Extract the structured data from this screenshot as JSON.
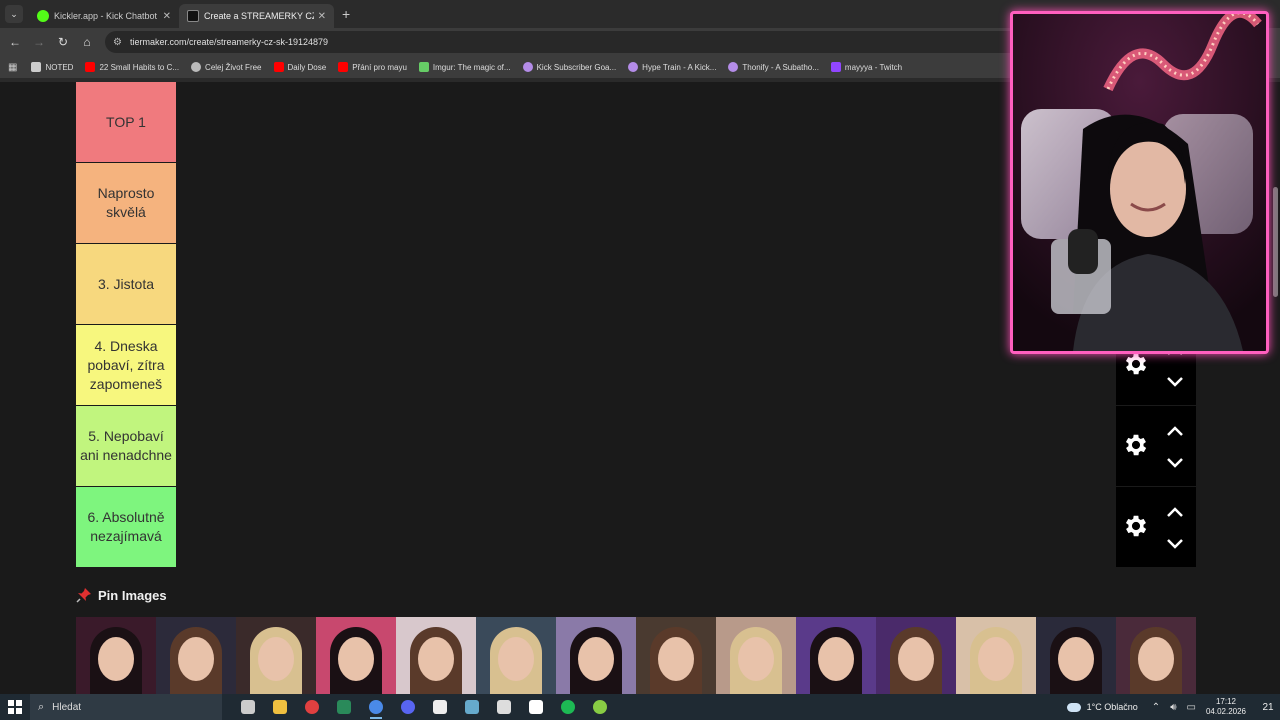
{
  "browser": {
    "tabs": [
      {
        "title": "Kickler.app - Kick Chatbot and",
        "active": false
      },
      {
        "title": "Create a STREAMERKY CZ/SK Ti",
        "active": true
      }
    ],
    "url": "tiermaker.com/create/streamerky-cz-sk-19124879",
    "bookmarks": [
      {
        "label": "NOTED",
        "color": "#cccccc"
      },
      {
        "label": "22 Small Habits to C...",
        "color": "#ff0000"
      },
      {
        "label": "Celej Život Free",
        "color": "#bbbbbb"
      },
      {
        "label": "Daily Dose",
        "color": "#ff0000"
      },
      {
        "label": "Přání pro mayu",
        "color": "#ff0000"
      },
      {
        "label": "Imgur: The magic of...",
        "color": "#66cc66"
      },
      {
        "label": "Kick Subscriber Goa...",
        "color": "#b48ce8"
      },
      {
        "label": "Hype Train - A Kick...",
        "color": "#b48ce8"
      },
      {
        "label": "Thonify - A Subatho...",
        "color": "#b48ce8"
      },
      {
        "label": "mayyya - Twitch",
        "color": "#9146ff"
      }
    ]
  },
  "tiers": [
    {
      "label": "TOP 1",
      "color": "#f07a7e"
    },
    {
      "label": "Naprosto skvělá",
      "color": "#f5b37e"
    },
    {
      "label": "3. Jistota",
      "color": "#f7d87e"
    },
    {
      "label": "4. Dneska pobaví, zítra zapomeneš",
      "color": "#f7f77e"
    },
    {
      "label": "5. Nepobaví ani nenadchne",
      "color": "#c1f57e"
    },
    {
      "label": "6. Absolutně nezajímavá",
      "color": "#7ef57e"
    }
  ],
  "pin_images": {
    "heading": "Pin Images",
    "thumb_colors": [
      "#3a1a2a",
      "#2c2a3a",
      "#3a2a2a",
      "#c8486e",
      "#d8c8cc",
      "#3a4a5a",
      "#8a7aa8",
      "#4a3a30",
      "#b89a8a",
      "#5a3a8a",
      "#4a2a6a",
      "#d8c0a8",
      "#2a2a3a",
      "#4a2a3a"
    ]
  },
  "taskbar": {
    "search_placeholder": "Hledat",
    "weather": "1°C  Oblačno",
    "time": "17:12",
    "date": "04.02.2026",
    "notification_count": "21",
    "app_colors": [
      "#cccccc",
      "#f0c040",
      "#e04040",
      "#2a8a5a",
      "#4a8ae8",
      "#5865f2",
      "#eeeeee",
      "#66aacc",
      "#dddddd",
      "#ffffff",
      "#1db954",
      "#88cc44"
    ]
  }
}
